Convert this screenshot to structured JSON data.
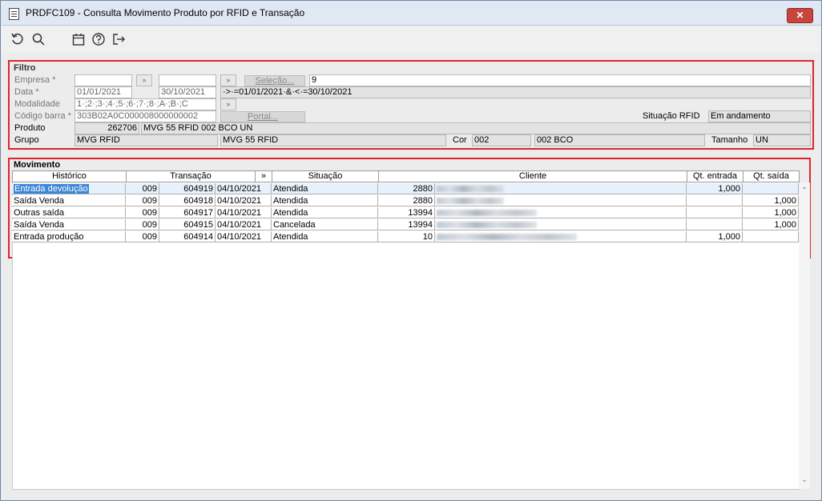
{
  "window": {
    "title": "PRDFC109 - Consulta Movimento Produto por RFID e Transação",
    "close": "✕"
  },
  "toolbar": {
    "icons": [
      "refresh-icon",
      "search-icon",
      "calendar-icon",
      "help-icon",
      "exit-icon"
    ]
  },
  "filtro": {
    "label": "Filtro",
    "empresa_label": "Empresa *",
    "data_label": "Data *",
    "data_from": "01/01/2021",
    "data_to": "30/10/2021",
    "data_expr": "·>·=01/01/2021·&·<·=30/10/2021",
    "selecao_label": "Seleção...",
    "selecao_value": "9",
    "modalidade_label": "Modalidade",
    "modalidade_value": "1·;2·;3·;4·;5·;6·;7·;8·;A·;B·;C",
    "codigo_label": "Código barra *",
    "codigo_value": "303B02A0C000008000000002",
    "portal_label": "Portal...",
    "situacao_label": "Situação RFID",
    "situacao_value": "Em andamento",
    "produto_label": "Produto",
    "produto_code": "262706",
    "produto_desc": "MVG 55 RFID 002 BCO UN",
    "grupo_label": "Grupo",
    "grupo_value": "MVG RFID",
    "grupo_desc": "MVG 55 RFID",
    "cor_label": "Cor",
    "cor_code": "002",
    "cor_desc": "002 BCO",
    "tamanho_label": "Tamanho",
    "tamanho_value": "UN",
    "lookup_glyph": "»"
  },
  "movimento": {
    "label": "Movimento",
    "columns": {
      "historico": "Histórico",
      "transacao": "Transação",
      "expand": "»",
      "situacao": "Situação",
      "cliente": "Cliente",
      "qt_entrada": "Qt. entrada",
      "qt_saida": "Qt. saída"
    },
    "rows": [
      {
        "historico": "Entrada devolução",
        "serie": "009",
        "transacao": "604919",
        "data": "04/10/2021",
        "situacao": "Atendida",
        "cliente_code": "2880",
        "qt_entrada": "1,000",
        "qt_saida": ""
      },
      {
        "historico": "Saída Venda",
        "serie": "009",
        "transacao": "604918",
        "data": "04/10/2021",
        "situacao": "Atendida",
        "cliente_code": "2880",
        "qt_entrada": "",
        "qt_saida": "1,000"
      },
      {
        "historico": "Outras saída",
        "serie": "009",
        "transacao": "604917",
        "data": "04/10/2021",
        "situacao": "Atendida",
        "cliente_code": "13994",
        "qt_entrada": "",
        "qt_saida": "1,000"
      },
      {
        "historico": "Saída Venda",
        "serie": "009",
        "transacao": "604915",
        "data": "04/10/2021",
        "situacao": "Cancelada",
        "cliente_code": "13994",
        "qt_entrada": "",
        "qt_saida": "1,000"
      },
      {
        "historico": "Entrada produção",
        "serie": "009",
        "transacao": "604914",
        "data": "04/10/2021",
        "situacao": "Atendida",
        "cliente_code": "10",
        "qt_entrada": "1,000",
        "qt_saida": ""
      }
    ]
  },
  "colors": {
    "highlight_border": "#e0242b",
    "selection": "#3b86d6",
    "close_button": "#c8453c"
  }
}
